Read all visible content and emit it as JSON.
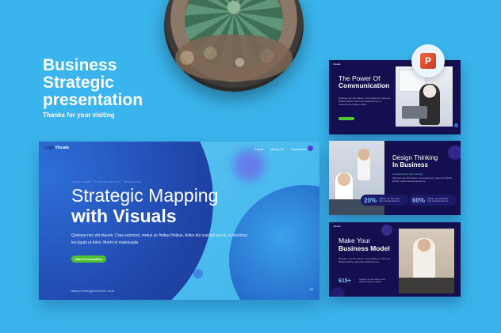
{
  "headline": {
    "lines": [
      "Business",
      "Strategic",
      "presentation"
    ],
    "subtitle": "Thanks for your visiting"
  },
  "main_slide": {
    "logo_prefix": "Logo",
    "logo_name": "Visuals",
    "nav": [
      "Home",
      "About Us",
      "Experience"
    ],
    "kicker": "Business Presentation Template",
    "title_line1": "Strategic Mapping",
    "title_line2": "with Visuals",
    "body": "Quisque nec elit mauris. Cras euismod, metus ac finibus finibus, tellus dui suscipit purus, a maximus leo ligula ut dolor. Morbi et malesuada",
    "button": "Start Presentation",
    "url": "www.reallygreatsite.com",
    "page": "02"
  },
  "slides": [
    {
      "logo": "Visuals",
      "title_line1": "The Power Of",
      "title_line2": "Communication",
      "body": "Quisque nec elit mauris. Cras euismod, metus ac finibus finibus, tellus dui suscipit purus, a maximus leo ligula ut dolor."
    },
    {
      "logo": "Visuals",
      "title_line1": "Design Thinking",
      "title_line2": "In Business",
      "label": "Creating Better Idea Strategy",
      "body": "Quisque nec elit mauris. Cras euismod, metus ac finibus finibus, tellus dui suscipit purus.",
      "stats": [
        {
          "value": "20%",
          "text": "Quisque nec elit mauris. Cras euismod metus ac"
        },
        {
          "value": "60%",
          "text": "Quisque nec elit mauris. Cras euismod metus ac"
        }
      ]
    },
    {
      "logo": "Visuals",
      "title_line1": "Make Your",
      "title_line2": "Business Model",
      "body": "Quisque nec elit mauris. Cras euismod, metus ac finibus finibus, tellus dui suscipit purus.",
      "stat_value": "615+",
      "stat_text": "Quisque nec elit mauris. Cras euismod metus ac finibus"
    }
  ],
  "app_badge": {
    "icon": "powerpoint-icon",
    "letter": "P"
  },
  "colors": {
    "background": "#3ab4ec",
    "slide_dark": "#140f4e",
    "accent_green": "#4cc233",
    "accent_blue": "#1f44a8"
  }
}
